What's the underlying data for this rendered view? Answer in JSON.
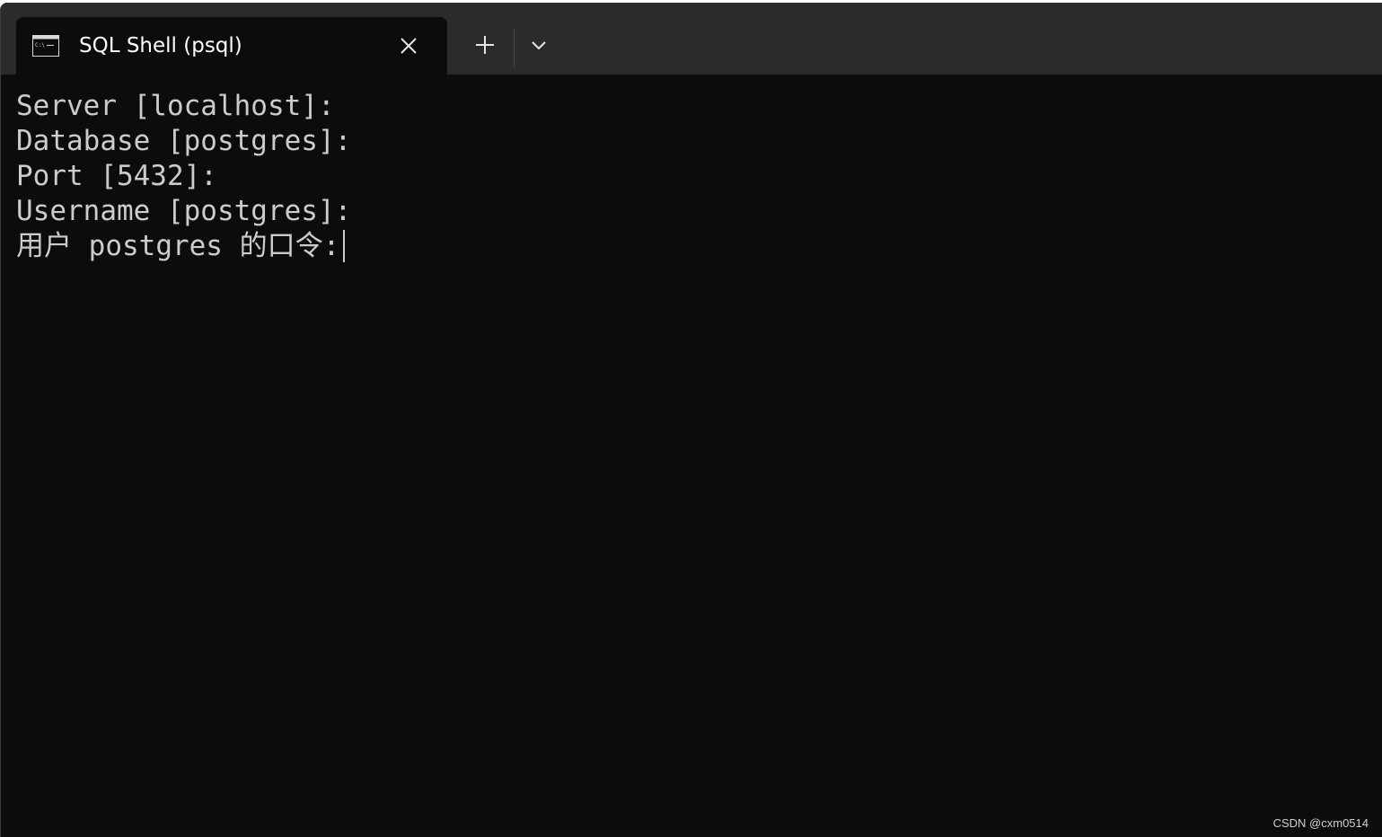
{
  "tab": {
    "title": "SQL Shell (psql)",
    "icon": "terminal-icon"
  },
  "tabbar": {
    "new_tab_icon": "plus-icon",
    "dropdown_icon": "chevron-down-icon",
    "close_icon": "close-icon"
  },
  "terminal": {
    "lines": [
      "Server [localhost]:",
      "Database [postgres]:",
      "Port [5432]:",
      "Username [postgres]:",
      "用户 postgres 的口令:"
    ]
  },
  "watermark": "CSDN @cxm0514",
  "colors": {
    "background": "#0c0c0c",
    "tabbar": "#2b2b2b",
    "text": "#cccccc"
  }
}
